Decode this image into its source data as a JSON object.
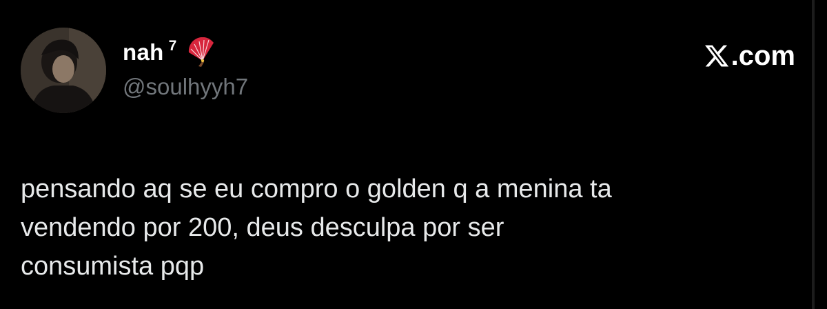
{
  "brand": {
    "logo_icon": "x-logo-icon",
    "suffix": ".com"
  },
  "author": {
    "display_name": "nah",
    "superscript": "7",
    "emoji_icon": "folding-fan-icon",
    "handle": "@soulhyyh7"
  },
  "tweet": {
    "text": "pensando aq se eu compro o golden q a menina ta\nvendendo por 200, deus desculpa por ser\nconsumista pqp"
  },
  "colors": {
    "background": "#000000",
    "text_primary": "#e7e9ea",
    "text_secondary": "#71767b",
    "fan_red": "#d7263d"
  }
}
